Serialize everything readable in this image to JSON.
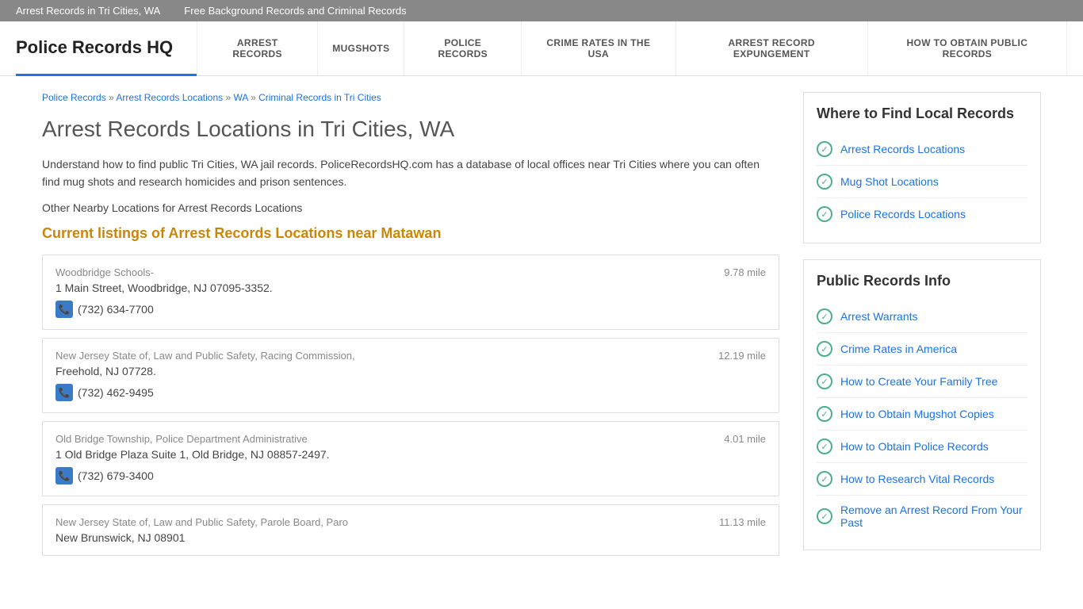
{
  "topbar": {
    "link1": "Arrest Records in Tri Cities, WA",
    "link2": "Free Background Records and Criminal Records"
  },
  "header": {
    "logo": "Police Records HQ",
    "nav": [
      {
        "label": "ARREST RECORDS",
        "href": "#"
      },
      {
        "label": "MUGSHOTS",
        "href": "#"
      },
      {
        "label": "POLICE RECORDS",
        "href": "#"
      },
      {
        "label": "CRIME RATES IN THE USA",
        "href": "#"
      },
      {
        "label": "ARREST RECORD EXPUNGEMENT",
        "href": "#"
      },
      {
        "label": "HOW TO OBTAIN PUBLIC RECORDS",
        "href": "#"
      }
    ]
  },
  "breadcrumb": {
    "items": [
      {
        "label": "Police Records",
        "href": "#"
      },
      {
        "label": "Arrest Records Locations",
        "href": "#"
      },
      {
        "label": "WA",
        "href": "#"
      },
      {
        "label": "Criminal Records in Tri Cities",
        "href": "#"
      }
    ]
  },
  "page": {
    "title": "Arrest Records Locations in Tri Cities, WA",
    "intro": "Understand how to find public Tri Cities, WA jail records. PoliceRecordsHQ.com has a database of local offices near Tri Cities where you can often find mug shots and research homicides and prison sentences.",
    "nearby_text": "Other Nearby Locations for Arrest Records Locations",
    "section_heading": "Current listings of Arrest Records Locations near Matawan"
  },
  "locations": [
    {
      "name": "Woodbridge Schools-",
      "address": "1 Main Street, Woodbridge, NJ 07095-3352.",
      "phone": "(732) 634-7700",
      "distance": "9.78 mile"
    },
    {
      "name": "New Jersey State of, Law and Public Safety, Racing Commission,",
      "address": "Freehold, NJ 07728.",
      "phone": "(732) 462-9495",
      "distance": "12.19 mile"
    },
    {
      "name": "Old Bridge Township, Police Department Administrative",
      "address": "1 Old Bridge Plaza Suite 1, Old Bridge, NJ 08857-2497.",
      "phone": "(732) 679-3400",
      "distance": "4.01 mile"
    },
    {
      "name": "New Jersey State of, Law and Public Safety, Parole Board, Paro",
      "address": "New Brunswick, NJ 08901",
      "phone": "",
      "distance": "11.13 mile"
    }
  ],
  "sidebar": {
    "section1_title": "Where to Find Local Records",
    "section1_links": [
      "Arrest Records Locations",
      "Mug Shot Locations",
      "Police Records Locations"
    ],
    "section2_title": "Public Records Info",
    "section2_links": [
      "Arrest Warrants",
      "Crime Rates in America",
      "How to Create Your Family Tree",
      "How to Obtain Mugshot Copies",
      "How to Obtain Police Records",
      "How to Research Vital Records",
      "Remove an Arrest Record From Your Past"
    ]
  }
}
